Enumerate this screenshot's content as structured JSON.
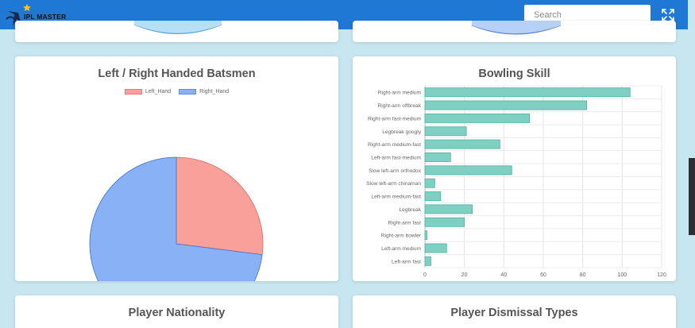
{
  "app": {
    "logo_text": "IPL MASTER"
  },
  "search": {
    "placeholder": "Search",
    "value": ""
  },
  "colors": {
    "topbar": "#1e78d4",
    "background": "#c7e6ef",
    "left_hand": "#f9a09a",
    "right_hand": "#88b2f5",
    "bar_fill": "#7fcfc2",
    "bar_stroke": "#4fb3a3"
  },
  "icons": {
    "logo": "ipl-logo-icon",
    "fullscreen": "fullscreen-icon"
  },
  "cards": {
    "batsmen": {
      "title": "Left / Right Handed Batsmen"
    },
    "bowling": {
      "title": "Bowling Skill"
    },
    "nationality": {
      "title": "Player Nationality"
    },
    "dismissal": {
      "title": "Player Dismissal Types"
    }
  },
  "chart_data": [
    {
      "type": "pie",
      "title": "Left / Right Handed Batsmen",
      "legend_position": "top",
      "slices": [
        {
          "name": "Left_Hand",
          "value": 27
        },
        {
          "name": "Right_Hand",
          "value": 73
        }
      ]
    },
    {
      "type": "bar",
      "orientation": "horizontal",
      "title": "Bowling Skill",
      "categories": [
        "Right-arm medium",
        "Right-arm offbreak",
        "Right-arm fast-medium",
        "Legbreak googly",
        "Right-arm medium-fast",
        "Left-arm fast-medium",
        "Slow left-arm orthodox",
        "Slow left-arm chinaman",
        "Left-arm medium-fast",
        "Legbreak",
        "Right-arm fast",
        "Right-arm bowler",
        "Left-arm medium",
        "Left-arm fast"
      ],
      "values": [
        104,
        82,
        53,
        21,
        38,
        13,
        44,
        5,
        8,
        24,
        20,
        1,
        11,
        3
      ],
      "xlim": [
        0,
        120
      ],
      "x_ticks": [
        "0",
        "20",
        "40",
        "60",
        "80",
        "100",
        "120"
      ],
      "grid": true
    }
  ]
}
